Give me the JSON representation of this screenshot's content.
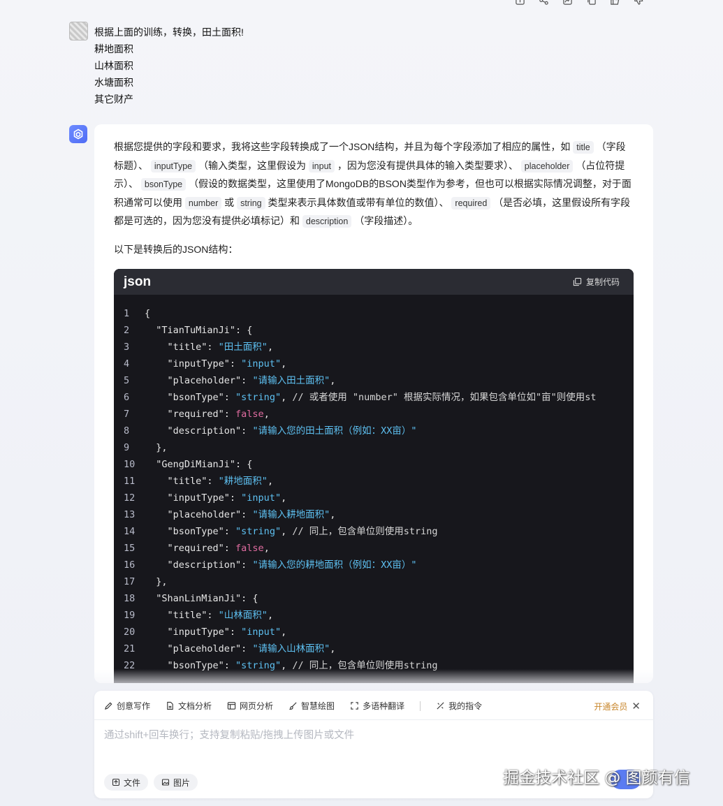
{
  "top_actions": [
    "translate-icon",
    "share-icon",
    "chart-icon",
    "copy-icon",
    "thumbs-up-icon",
    "thumbs-down-icon"
  ],
  "user_message": {
    "lines": [
      "根据上面的训练，转换，田土面积!",
      "耕地面积",
      "山林面积",
      "水塘面积",
      "其它财产"
    ]
  },
  "assistant": {
    "para1": {
      "t1": "根据您提供的字段和要求，我将这些字段转换成了一个JSON结构，并且为每个字段添加了相应的属性，如",
      "c1": "title",
      "t2": "（字段标题）、",
      "c2": "inputType",
      "t3": "（输入类型，这里假设为",
      "c3": "input",
      "t4": "，因为您没有提供具体的输入类型要求）、",
      "c4": "placeholder",
      "t5": "（占位符提示）、",
      "c5": "bsonType",
      "t6": "（假设的数据类型，这里使用了MongoDB的BSON类型作为参考，但也可以根据实际情况调整，对于面积通常可以使用",
      "c6": "number",
      "t7": "或",
      "c7": "string",
      "t8": "类型来表示具体数值或带有单位的数值）、",
      "c8": "required",
      "t9": "（是否必填，这里假设所有字段都是可选的，因为您没有提供必填标记）和",
      "c9": "description",
      "t10": "（字段描述）。"
    },
    "para2": "以下是转换后的JSON结构：",
    "code": {
      "lang": "json",
      "copy_label": "复制代码",
      "lines": [
        {
          "n": "1",
          "segs": [
            [
              "k",
              "{"
            ]
          ]
        },
        {
          "n": "2",
          "segs": [
            [
              "k",
              "  \"TianTuMianJi\": {"
            ]
          ]
        },
        {
          "n": "3",
          "segs": [
            [
              "k",
              "    \"title\": "
            ],
            [
              "s",
              "\"田土面积\""
            ],
            [
              "k",
              ","
            ]
          ]
        },
        {
          "n": "4",
          "segs": [
            [
              "k",
              "    \"inputType\": "
            ],
            [
              "s",
              "\"input\""
            ],
            [
              "k",
              ","
            ]
          ]
        },
        {
          "n": "5",
          "segs": [
            [
              "k",
              "    \"placeholder\": "
            ],
            [
              "s",
              "\"请输入田土面积\""
            ],
            [
              "k",
              ","
            ]
          ]
        },
        {
          "n": "6",
          "segs": [
            [
              "k",
              "    \"bsonType\": "
            ],
            [
              "s",
              "\"string\""
            ],
            [
              "k",
              ", "
            ],
            [
              "c",
              "// 或者使用 \"number\" 根据实际情况，如果包含单位如\"亩\"则使用st"
            ]
          ]
        },
        {
          "n": "7",
          "segs": [
            [
              "k",
              "    \"required\": "
            ],
            [
              "b",
              "false"
            ],
            [
              "k",
              ","
            ]
          ]
        },
        {
          "n": "8",
          "segs": [
            [
              "k",
              "    \"description\": "
            ],
            [
              "s",
              "\"请输入您的田土面积（例如：XX亩）\""
            ]
          ]
        },
        {
          "n": "9",
          "segs": [
            [
              "k",
              "  },"
            ]
          ]
        },
        {
          "n": "10",
          "segs": [
            [
              "k",
              "  \"GengDiMianJi\": {"
            ]
          ]
        },
        {
          "n": "11",
          "segs": [
            [
              "k",
              "    \"title\": "
            ],
            [
              "s",
              "\"耕地面积\""
            ],
            [
              "k",
              ","
            ]
          ]
        },
        {
          "n": "12",
          "segs": [
            [
              "k",
              "    \"inputType\": "
            ],
            [
              "s",
              "\"input\""
            ],
            [
              "k",
              ","
            ]
          ]
        },
        {
          "n": "13",
          "segs": [
            [
              "k",
              "    \"placeholder\": "
            ],
            [
              "s",
              "\"请输入耕地面积\""
            ],
            [
              "k",
              ","
            ]
          ]
        },
        {
          "n": "14",
          "segs": [
            [
              "k",
              "    \"bsonType\": "
            ],
            [
              "s",
              "\"string\""
            ],
            [
              "k",
              ", "
            ],
            [
              "c",
              "// 同上，包含单位则使用string"
            ]
          ]
        },
        {
          "n": "15",
          "segs": [
            [
              "k",
              "    \"required\": "
            ],
            [
              "b",
              "false"
            ],
            [
              "k",
              ","
            ]
          ]
        },
        {
          "n": "16",
          "segs": [
            [
              "k",
              "    \"description\": "
            ],
            [
              "s",
              "\"请输入您的耕地面积（例如：XX亩）\""
            ]
          ]
        },
        {
          "n": "17",
          "segs": [
            [
              "k",
              "  },"
            ]
          ]
        },
        {
          "n": "18",
          "segs": [
            [
              "k",
              "  \"ShanLinMianJi\": {"
            ]
          ]
        },
        {
          "n": "19",
          "segs": [
            [
              "k",
              "    \"title\": "
            ],
            [
              "s",
              "\"山林面积\""
            ],
            [
              "k",
              ","
            ]
          ]
        },
        {
          "n": "20",
          "segs": [
            [
              "k",
              "    \"inputType\": "
            ],
            [
              "s",
              "\"input\""
            ],
            [
              "k",
              ","
            ]
          ]
        },
        {
          "n": "21",
          "segs": [
            [
              "k",
              "    \"placeholder\": "
            ],
            [
              "s",
              "\"请输入山林面积\""
            ],
            [
              "k",
              ","
            ]
          ]
        },
        {
          "n": "22",
          "segs": [
            [
              "k",
              "    \"bsonType\": "
            ],
            [
              "s",
              "\"string\""
            ],
            [
              "k",
              ", "
            ],
            [
              "c",
              "// 同上，包含单位则使用string"
            ]
          ]
        }
      ]
    }
  },
  "input_panel": {
    "tools": [
      {
        "label": "创意写作",
        "icon": "pen-icon"
      },
      {
        "label": "文档分析",
        "icon": "document-icon"
      },
      {
        "label": "网页分析",
        "icon": "webpage-icon"
      },
      {
        "label": "智慧绘图",
        "icon": "brush-icon"
      },
      {
        "label": "多语种翻译",
        "icon": "translate-icon"
      }
    ],
    "my_commands": "我的指令",
    "vip": "开通会员",
    "placeholder": "通过shift+回车换行；支持复制粘贴/拖拽上传图片或文件",
    "file_label": "文件",
    "image_label": "图片"
  },
  "watermark": "掘金技术社区 @ 图颜有信"
}
